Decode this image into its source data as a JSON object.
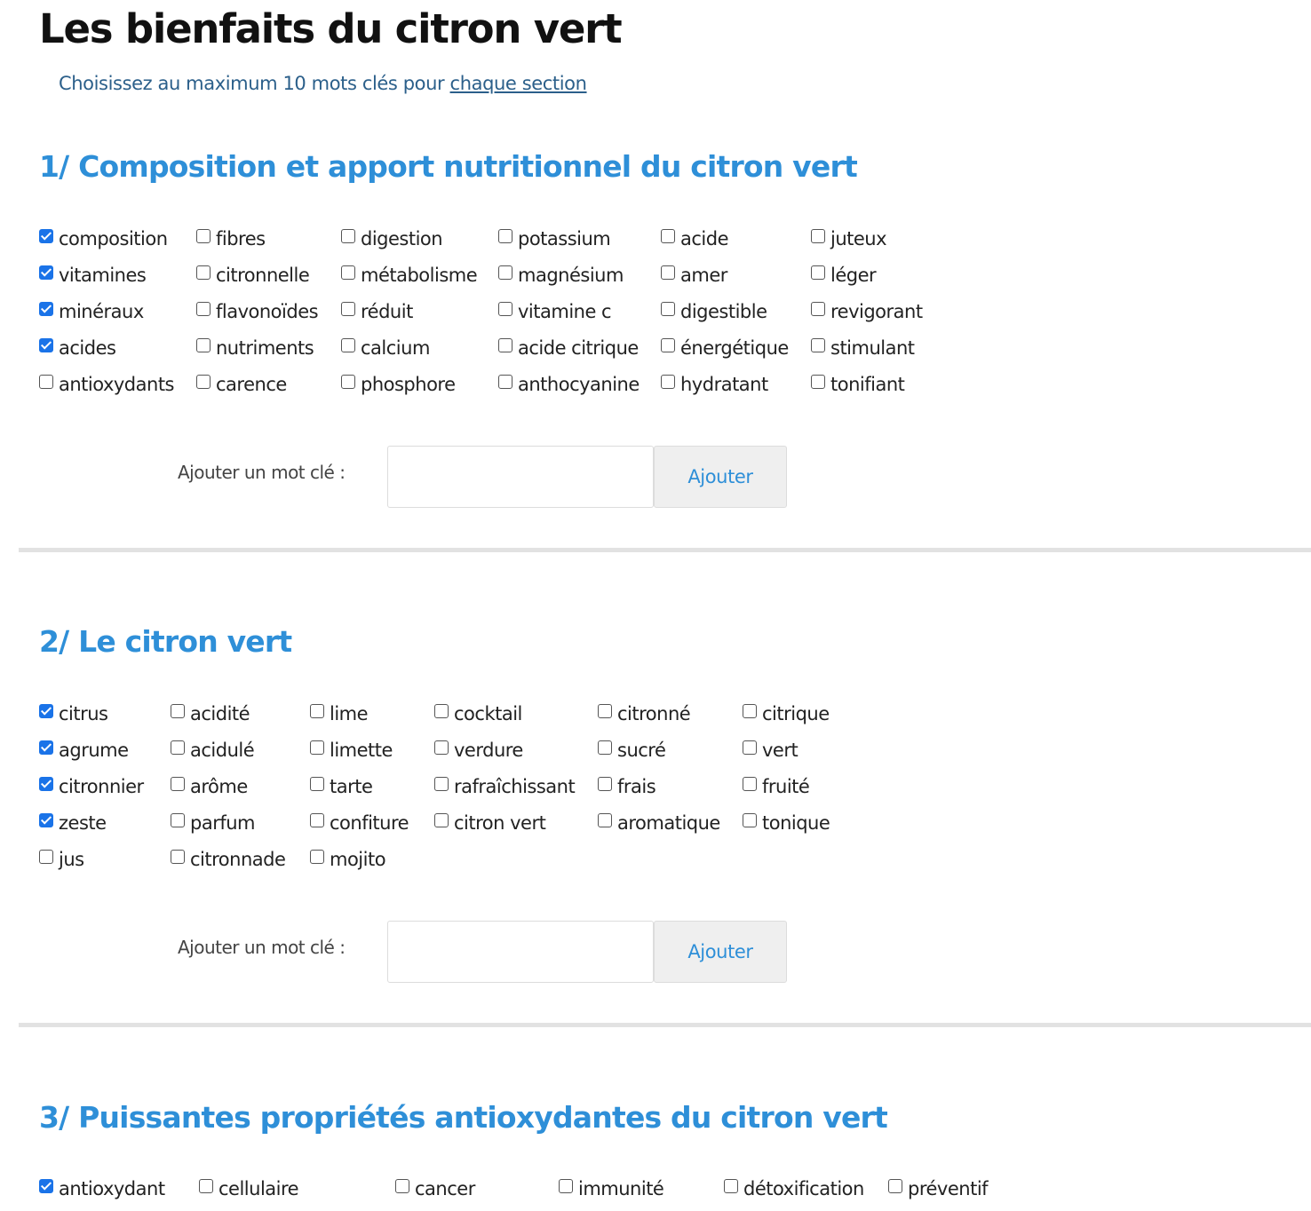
{
  "page": {
    "title": "Les bienfaits du citron vert",
    "instruction": "Choisissez au maximum 10 mots clés pour ",
    "instruction_link": "chaque section"
  },
  "add_keyword": {
    "label": "Ajouter un mot clé :",
    "button": "Ajouter"
  },
  "sections": [
    {
      "title": "1/ Composition et apport nutritionnel du citron vert",
      "columns": [
        [
          {
            "label": "composition",
            "checked": true
          },
          {
            "label": "vitamines",
            "checked": true
          },
          {
            "label": "minéraux",
            "checked": true
          },
          {
            "label": "acides",
            "checked": true
          },
          {
            "label": "antioxydants",
            "checked": false
          }
        ],
        [
          {
            "label": "fibres",
            "checked": false
          },
          {
            "label": "citronnelle",
            "checked": false
          },
          {
            "label": "flavonoïdes",
            "checked": false
          },
          {
            "label": "nutriments",
            "checked": false
          },
          {
            "label": "carence",
            "checked": false
          }
        ],
        [
          {
            "label": "digestion",
            "checked": false
          },
          {
            "label": "métabolisme",
            "checked": false
          },
          {
            "label": "réduit",
            "checked": false
          },
          {
            "label": "calcium",
            "checked": false
          },
          {
            "label": "phosphore",
            "checked": false
          }
        ],
        [
          {
            "label": "potassium",
            "checked": false
          },
          {
            "label": "magnésium",
            "checked": false
          },
          {
            "label": "vitamine c",
            "checked": false
          },
          {
            "label": "acide citrique",
            "checked": false
          },
          {
            "label": "anthocyanine",
            "checked": false
          }
        ],
        [
          {
            "label": "acide",
            "checked": false
          },
          {
            "label": "amer",
            "checked": false
          },
          {
            "label": "digestible",
            "checked": false
          },
          {
            "label": "énergétique",
            "checked": false
          },
          {
            "label": "hydratant",
            "checked": false
          }
        ],
        [
          {
            "label": "juteux",
            "checked": false
          },
          {
            "label": "léger",
            "checked": false
          },
          {
            "label": "revigorant",
            "checked": false
          },
          {
            "label": "stimulant",
            "checked": false
          },
          {
            "label": "tonifiant",
            "checked": false
          }
        ]
      ]
    },
    {
      "title": "2/ Le citron vert",
      "columns": [
        [
          {
            "label": "citrus",
            "checked": true
          },
          {
            "label": "agrume",
            "checked": true
          },
          {
            "label": "citronnier",
            "checked": true
          },
          {
            "label": "zeste",
            "checked": true
          },
          {
            "label": "jus",
            "checked": false
          }
        ],
        [
          {
            "label": "acidité",
            "checked": false
          },
          {
            "label": "acidulé",
            "checked": false
          },
          {
            "label": "arôme",
            "checked": false
          },
          {
            "label": "parfum",
            "checked": false
          },
          {
            "label": "citronnade",
            "checked": false
          }
        ],
        [
          {
            "label": "lime",
            "checked": false
          },
          {
            "label": "limette",
            "checked": false
          },
          {
            "label": "tarte",
            "checked": false
          },
          {
            "label": "confiture",
            "checked": false
          },
          {
            "label": "mojito",
            "checked": false
          }
        ],
        [
          {
            "label": "cocktail",
            "checked": false
          },
          {
            "label": "verdure",
            "checked": false
          },
          {
            "label": "rafraîchissant",
            "checked": false
          },
          {
            "label": "citron vert",
            "checked": false
          }
        ],
        [
          {
            "label": "citronné",
            "checked": false
          },
          {
            "label": "sucré",
            "checked": false
          },
          {
            "label": "frais",
            "checked": false
          },
          {
            "label": "aromatique",
            "checked": false
          }
        ],
        [
          {
            "label": "citrique",
            "checked": false
          },
          {
            "label": "vert",
            "checked": false
          },
          {
            "label": "fruité",
            "checked": false
          },
          {
            "label": "tonique",
            "checked": false
          }
        ]
      ]
    },
    {
      "title": "3/ Puissantes propriétés antioxydantes du citron vert",
      "columns": [
        [
          {
            "label": "antioxydant",
            "checked": true
          }
        ],
        [
          {
            "label": "cellulaire",
            "checked": false
          }
        ],
        [
          {
            "label": "cancer",
            "checked": false
          }
        ],
        [
          {
            "label": "immunité",
            "checked": false
          }
        ],
        [
          {
            "label": "détoxification",
            "checked": false
          }
        ],
        [
          {
            "label": "préventif",
            "checked": false
          }
        ]
      ]
    }
  ]
}
